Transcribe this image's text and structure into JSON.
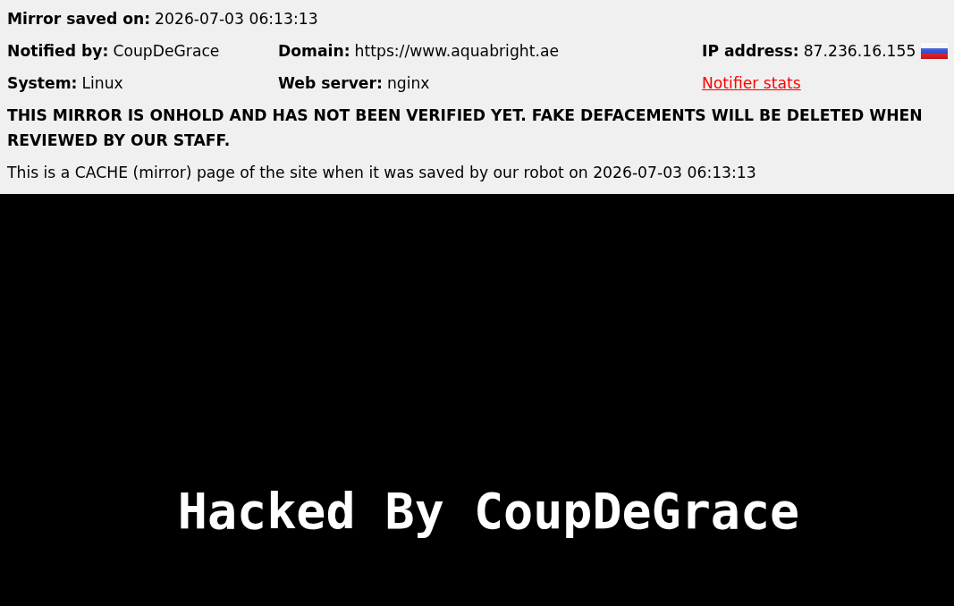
{
  "mirror_info": {
    "rows": [
      [
        {
          "kind": "field",
          "label": "Mirror saved on:",
          "value": "2026-07-03 06:13:13"
        }
      ],
      [
        {
          "kind": "field",
          "label": "Notified by:",
          "value": "CoupDeGrace"
        },
        {
          "kind": "field",
          "label": "Domain:",
          "value": "https://www.aquabright.ae"
        },
        {
          "kind": "flagged",
          "label": "IP address:",
          "value": "87.236.16.155"
        }
      ],
      [
        {
          "kind": "field",
          "label": "System:",
          "value": "Linux"
        },
        {
          "kind": "field",
          "label": "Web server:",
          "value": "nginx"
        },
        {
          "kind": "link",
          "text": "Notifier stats"
        }
      ]
    ],
    "warning": "THIS MIRROR IS ONHOLD AND HAS NOT BEEN VERIFIED YET. FAKE DEFACEMENTS WILL BE DELETED WHEN REVIEWED BY OUR STAFF.",
    "note": "This is a CACHE (mirror) page of the site when it was saved by our robot on 2026-07-03 06:13:13"
  },
  "mirrored_page": {
    "heading": "Hacked By CoupDeGrace"
  }
}
